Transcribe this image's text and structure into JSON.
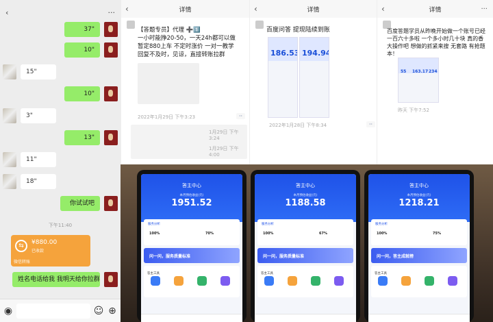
{
  "chat": {
    "messages": [
      {
        "side": "me",
        "text": "37\""
      },
      {
        "side": "me",
        "text": "10\""
      },
      {
        "side": "other",
        "text": "15\""
      },
      {
        "side": "me",
        "text": "10\""
      },
      {
        "side": "other",
        "text": "3\""
      },
      {
        "side": "me",
        "text": "13\""
      },
      {
        "side": "other",
        "text": "11\""
      },
      {
        "side": "other",
        "text": "18\""
      },
      {
        "side": "me",
        "text": "你试试吧"
      },
      {
        "side": "me",
        "text": "姓名电话给我 我明天给你拉群"
      }
    ],
    "time_divider": "下午11:40",
    "payment": {
      "amount": "¥880.00",
      "status": "已收款",
      "caption": "微信转账"
    }
  },
  "posts": [
    {
      "header": "详情",
      "text": "【答题专员】代理 ➕1️⃣\n一小时能挣20-50，一天24h都可以做\n暂定880上车 不定时涨价 一对一教学\n回复不及时，见谅，直接转账拉群",
      "time": "2022年1月29日 下午3:23",
      "comment_times": [
        "1月29日 下午3:24",
        "1月29日 下午4:00"
      ]
    },
    {
      "header": "详情",
      "text": "百度问答 提现陆续到账",
      "time": "2022年1月28日 下午8:34",
      "figures": [
        "186.53",
        "194.94"
      ]
    },
    {
      "header": "详情",
      "text": "百度答题学员从昨晚开始做一个账号已经\n一百六十多啦 一个多小时几十块 真的香\n大操作吧 想做的抓紧来搜 无套路 有抢题\n本！",
      "time": "昨天 下午7:52",
      "figures": [
        "55",
        "163.17",
        "234"
      ]
    }
  ],
  "phones": [
    {
      "title": "答主中心",
      "balance": "1951.52",
      "stats": [
        "100%",
        "70%"
      ]
    },
    {
      "title": "答主中心",
      "balance": "1188.58",
      "stats": [
        "100%",
        "67%"
      ]
    },
    {
      "title": "答主中心",
      "balance": "1218.21",
      "stats": [
        "100%",
        "75%"
      ]
    }
  ],
  "phone_common": {
    "balance_label": "本月预估收益(元)",
    "tab": "服务分析",
    "banner": [
      "问一问，服务质量标准",
      "问一问，服务质量标准",
      "问一问，答主成就榜"
    ],
    "tools_label": "答主工具"
  }
}
